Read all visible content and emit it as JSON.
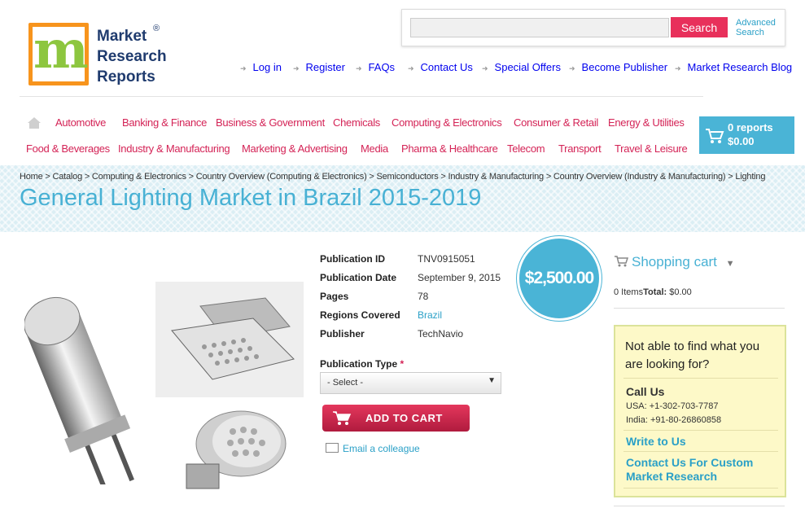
{
  "logo": {
    "line1": "Market",
    "line2": "Research",
    "line3": "Reports",
    "reg": "®"
  },
  "search": {
    "placeholder": "",
    "button": "Search",
    "advanced_line1": "Advanced",
    "advanced_line2": "Search"
  },
  "topnav": [
    "Log in",
    "Register",
    "FAQs",
    "Contact Us",
    "Special Offers",
    "Become Publisher",
    "Market Research Blog"
  ],
  "categories_row1": [
    "Automotive",
    "Banking & Finance",
    "Business & Government",
    "Chemicals",
    "Computing & Electronics",
    "Consumer & Retail",
    "Energy & Utilities"
  ],
  "categories_row2": [
    "Food & Beverages",
    "Industry & Manufacturing",
    "Marketing & Advertising",
    "Media",
    "Pharma & Healthcare",
    "Telecom",
    "Transport",
    "Travel & Leisure"
  ],
  "cart": {
    "reports": "0 reports",
    "total": "$0.00"
  },
  "breadcrumb": "Home > Catalog > Computing & Electronics > Country Overview (Computing & Electronics) > Semiconductors > Industry & Manufacturing > Country Overview (Industry & Manufacturing) > Lighting",
  "title": "General Lighting Market in Brazil 2015-2019",
  "details": {
    "pubid_label": "Publication ID",
    "pubid": "TNV0915051",
    "date_label": "Publication Date",
    "date": "September 9, 2015",
    "pages_label": "Pages",
    "pages": "78",
    "regions_label": "Regions Covered",
    "regions": "Brazil",
    "publisher_label": "Publisher",
    "publisher": "TechNavio"
  },
  "price": "$2,500.00",
  "pubtype": {
    "label": "Publication Type",
    "required": "*",
    "selected": "- Select -"
  },
  "add_to_cart": "ADD TO CART",
  "email_colleague": "Email a colleague",
  "shopping_cart": {
    "title": "Shopping cart",
    "items": "0 Items",
    "total_label": "Total:",
    "total": "$0.00"
  },
  "help": {
    "question": "Not able to find what you are looking for?",
    "call_us": "Call Us",
    "usa": "USA: +1-302-703-7787",
    "india": "India: +91-80-26860858",
    "write": "Write to Us",
    "custom": "Contact Us For Custom Market Research"
  },
  "colors": {
    "accent_blue": "#48b1d4",
    "category_red": "#d42356",
    "button_red": "#e8305b"
  }
}
